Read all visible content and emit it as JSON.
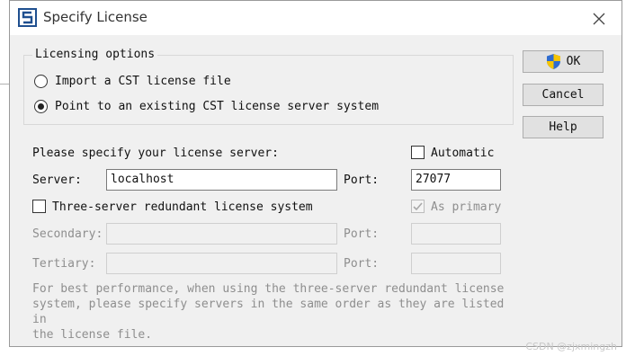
{
  "window": {
    "title": "Specify License",
    "close_icon": "close-icon",
    "app_icon": "cst-logo-icon"
  },
  "licensing_options": {
    "legend": "Licensing options",
    "options": [
      {
        "label": "Import a CST license file",
        "selected": false
      },
      {
        "label": "Point to an existing CST license server system",
        "selected": true
      }
    ]
  },
  "server_section": {
    "prompt": "Please specify your license server:",
    "automatic_label": "Automatic",
    "automatic_checked": false,
    "server_label": "Server:",
    "server_value": "localhost",
    "port_label": "Port:",
    "port_value": "27077",
    "three_server_label": "Three-server redundant license system",
    "three_server_checked": false,
    "as_primary_label": "As primary",
    "as_primary_checked": true,
    "secondary_label": "Secondary:",
    "secondary_port_label": "Port:",
    "tertiary_label": "Tertiary:",
    "tertiary_port_label": "Port:",
    "note": "For best performance, when using the three-server redundant license\nsystem, please specify servers in the same order as they are listed in\nthe license file."
  },
  "buttons": {
    "ok": "OK",
    "cancel": "Cancel",
    "help": "Help"
  },
  "watermark": "CSDN @zjxmingzh",
  "colors": {
    "dialog_bg": "#f0f0f0",
    "shield_blue": "#2f6ccf",
    "shield_yellow": "#f6c400"
  }
}
